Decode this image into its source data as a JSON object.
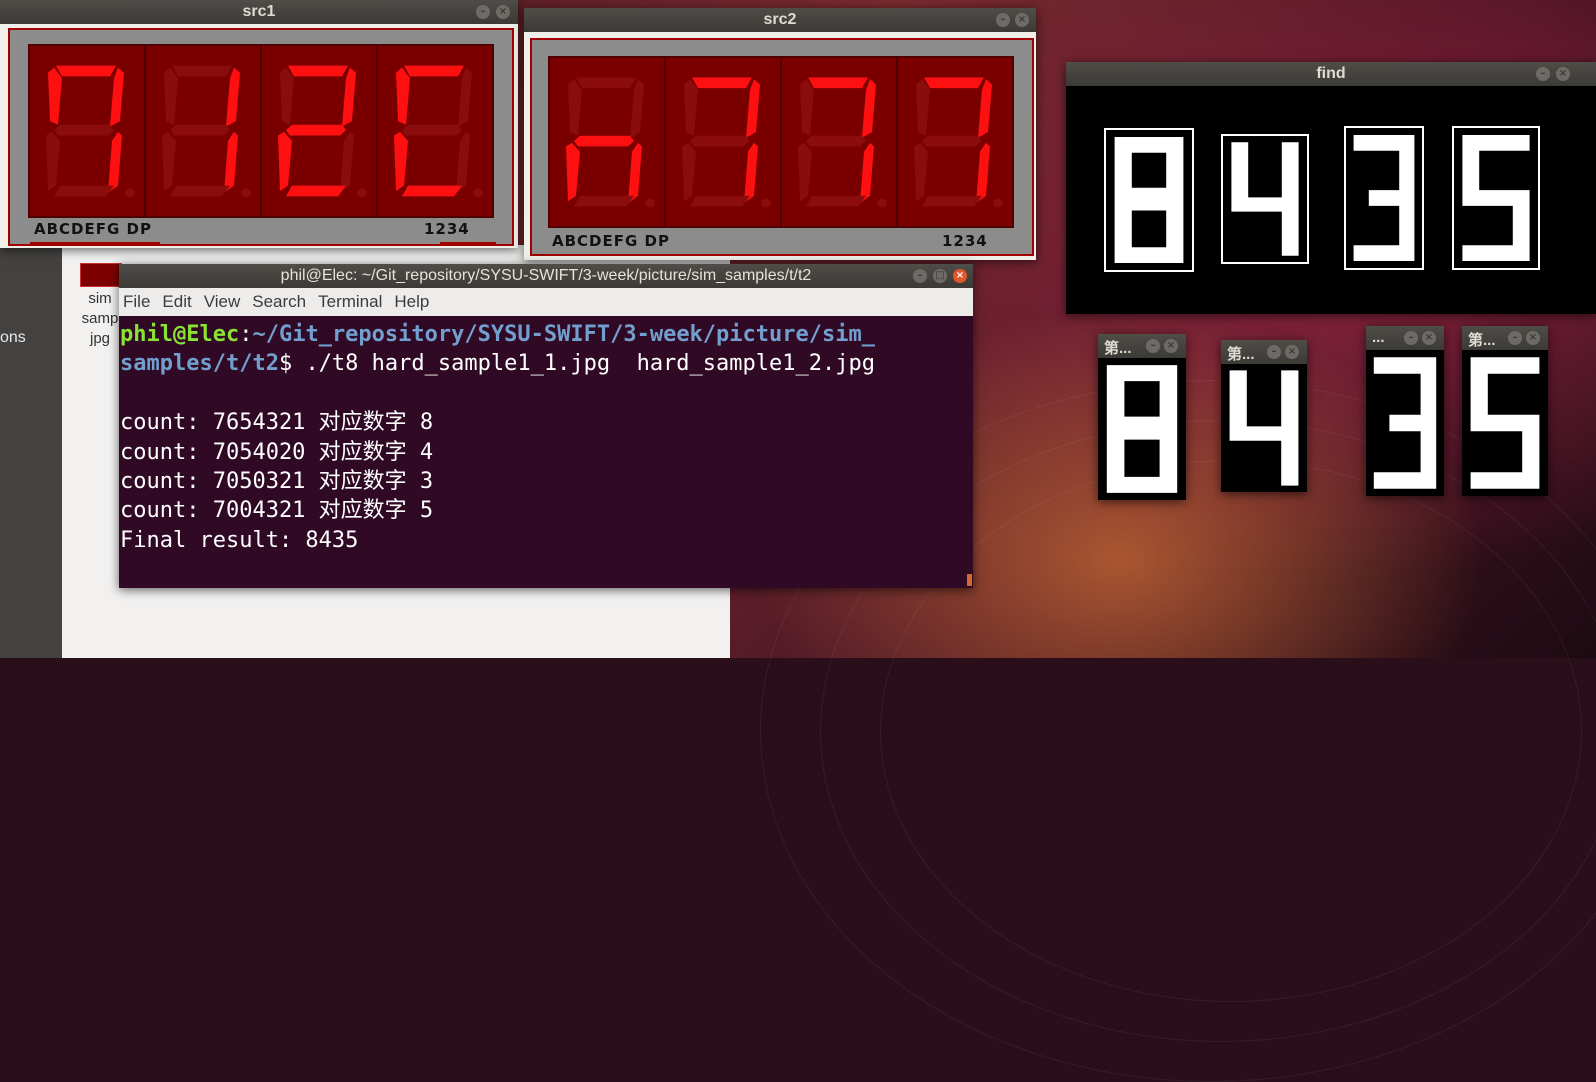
{
  "desktop": {
    "background": "ubuntu-wallpaper"
  },
  "file_manager": {
    "sidebar_label": "ons",
    "file_name_lines": [
      "sim",
      "samp",
      "jpg"
    ]
  },
  "src1": {
    "title": "src1",
    "pin_labels": "ABCDEFG  DP",
    "digit_numbers": "1234",
    "digit_segments": [
      "abcf",
      "bc",
      "abdeg",
      "adef"
    ],
    "lit_color": "#ff1010",
    "unlit_color": "#8a0c0c"
  },
  "src2": {
    "title": "src2",
    "pin_labels": "ABCDEFG  DP",
    "digit_numbers": "1234",
    "digit_segments": [
      "ceg",
      "abc",
      "abc",
      "abc"
    ],
    "lit_color": "#ff1010",
    "unlit_color": "#8a0c0c"
  },
  "terminal": {
    "title": "phil@Elec: ~/Git_repository/SYSU-SWIFT/3-week/picture/sim_samples/t/t2",
    "menu": [
      "File",
      "Edit",
      "View",
      "Search",
      "Terminal",
      "Help"
    ],
    "prompt_user": "phil@Elec",
    "prompt_path_line1": "~/Git_repository/SYSU-SWIFT/3-week/picture/sim_",
    "prompt_path_line2": "samples/t/t2",
    "command": "$ ./t8 hard_sample1_1.jpg  hard_sample1_2.jpg",
    "output": [
      "count: 7654321 对应数字 8",
      "count: 7054020 对应数字 4",
      "count: 7050321 对应数字 3",
      "count: 7004321 对应数字 5",
      "Final result: 8435"
    ]
  },
  "find": {
    "title": "find",
    "digits": [
      "8",
      "4",
      "3",
      "5"
    ]
  },
  "small_windows": [
    {
      "title": "第...",
      "digit": "8"
    },
    {
      "title": "第...",
      "digit": "4"
    },
    {
      "title": "...",
      "digit": "3"
    },
    {
      "title": "第...",
      "digit": "5"
    }
  ],
  "window_buttons": {
    "minimize": "–",
    "maximize": "□",
    "close": "×"
  }
}
